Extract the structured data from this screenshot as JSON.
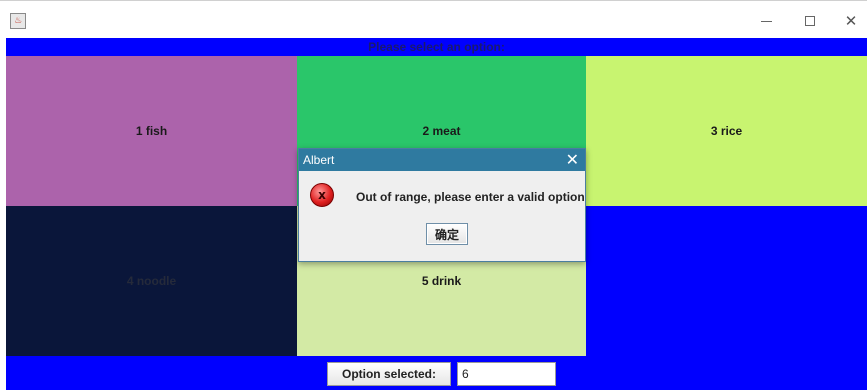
{
  "window": {
    "icon": "java-cup-icon",
    "controls": {
      "minimize": "—",
      "maximize": "□",
      "close": "✕"
    }
  },
  "header": {
    "text": "Please select an option:"
  },
  "tiles": [
    {
      "label": "1 fish",
      "color": "#ac63ab"
    },
    {
      "label": "2 meat",
      "color": "#2ac66a"
    },
    {
      "label": "3 rice",
      "color": "#c8f470"
    },
    {
      "label": "4 noodle",
      "color": "#0a163a"
    },
    {
      "label": "5 drink",
      "color": "#d3eaa5"
    },
    {
      "label": "",
      "color": "#0000ff"
    }
  ],
  "footer": {
    "button_label": "Option selected:",
    "input_value": "6"
  },
  "dialog": {
    "title": "Albert",
    "close": "✕",
    "icon": "error-icon",
    "icon_glyph": "x",
    "message": "Out of range, please enter a valid option",
    "ok_label": "确定"
  },
  "colors": {
    "panel_blue": "#0000ff",
    "dialog_title": "#2f7aa0"
  }
}
